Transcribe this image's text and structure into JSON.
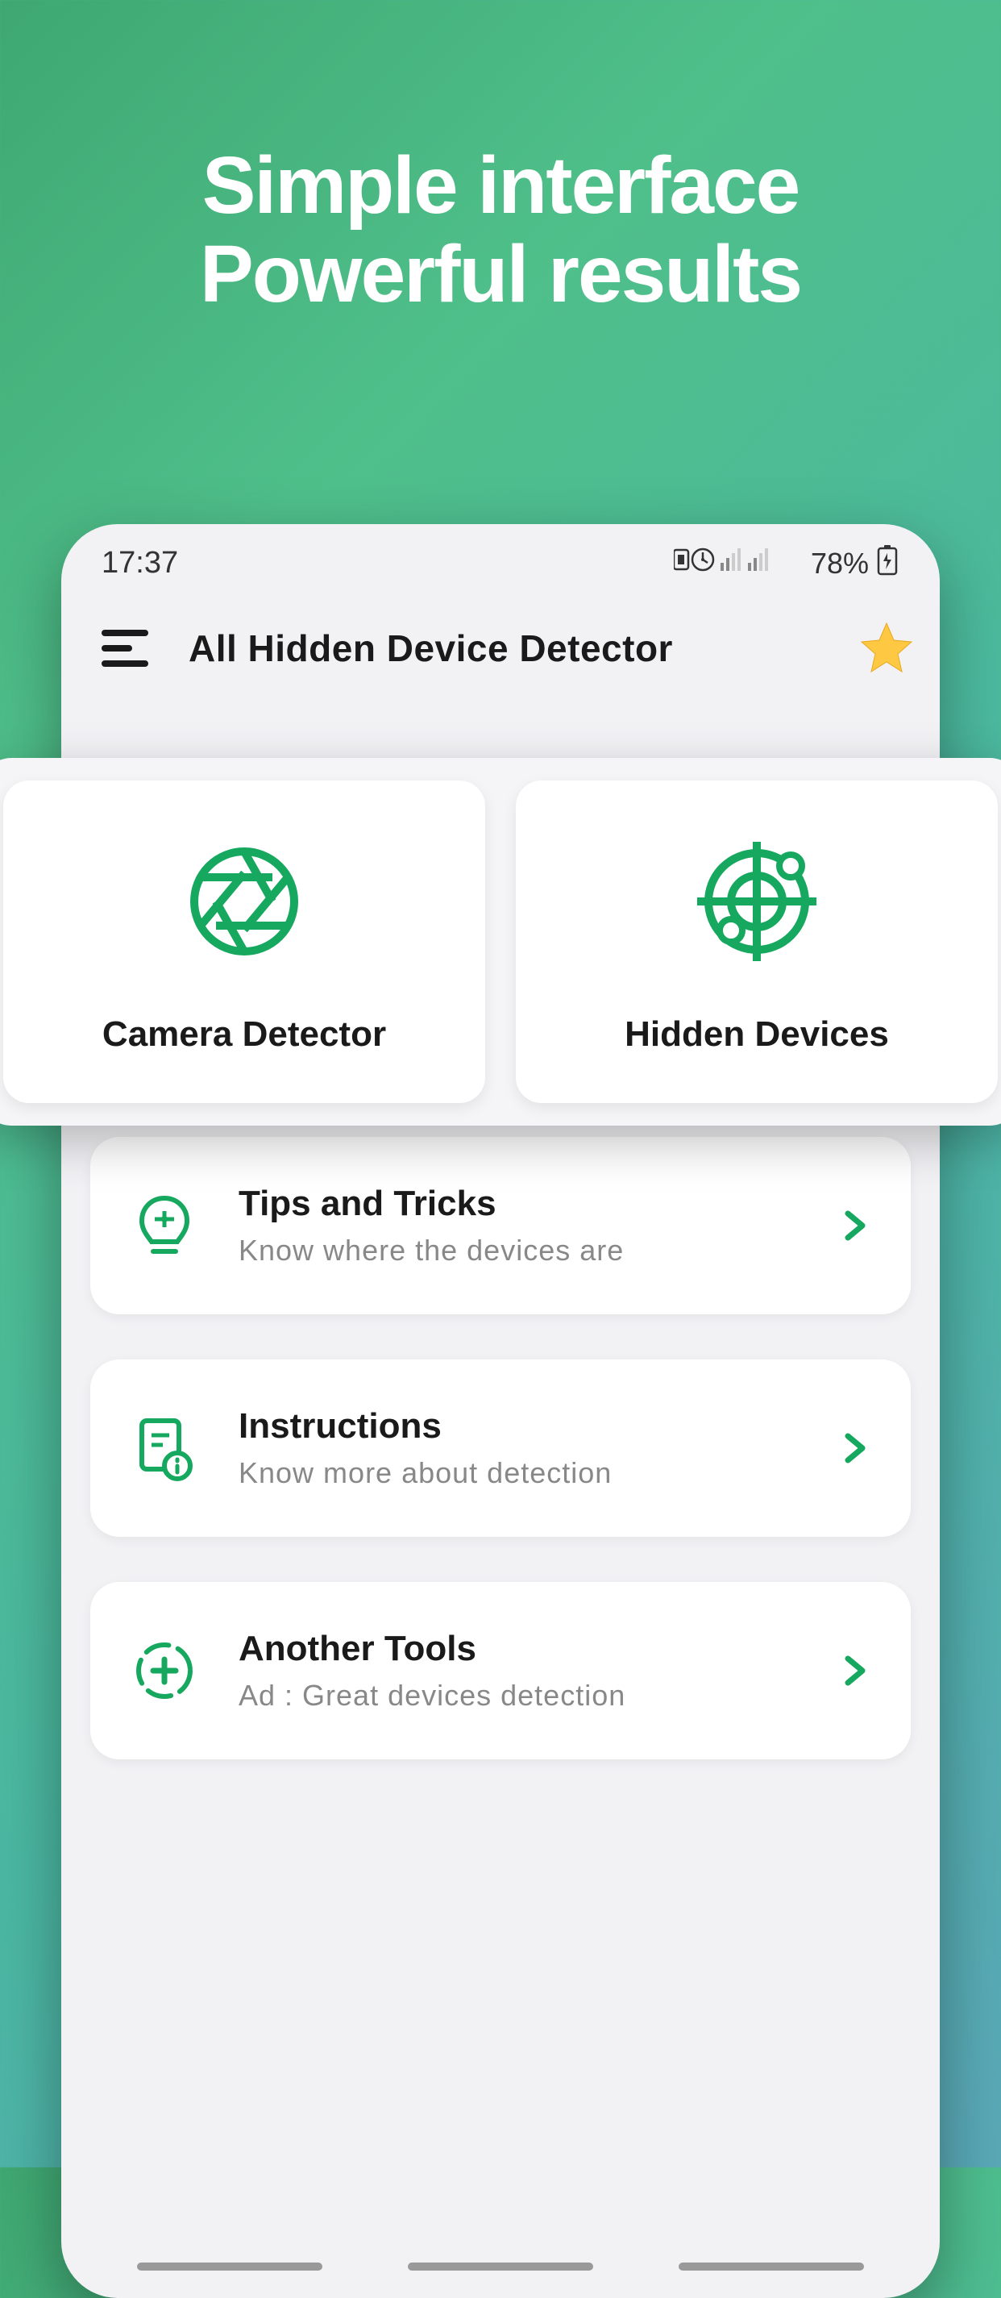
{
  "headline": {
    "line1": "Simple interface",
    "line2": "Powerful results"
  },
  "status": {
    "time": "17:37",
    "battery": "78%"
  },
  "header": {
    "title": "All Hidden Device Detector"
  },
  "bigCards": [
    {
      "label": "Camera Detector",
      "icon": "aperture"
    },
    {
      "label": "Hidden Devices",
      "icon": "radar"
    }
  ],
  "listItems": [
    {
      "title": "Tips and Tricks",
      "subtitle": "Know where the devices are",
      "icon": "bulb"
    },
    {
      "title": "Instructions",
      "subtitle": "Know more about detection",
      "icon": "doc"
    },
    {
      "title": "Another Tools",
      "subtitle": "Ad : Great devices detection",
      "icon": "plus"
    }
  ],
  "colors": {
    "accent": "#16a85f"
  }
}
